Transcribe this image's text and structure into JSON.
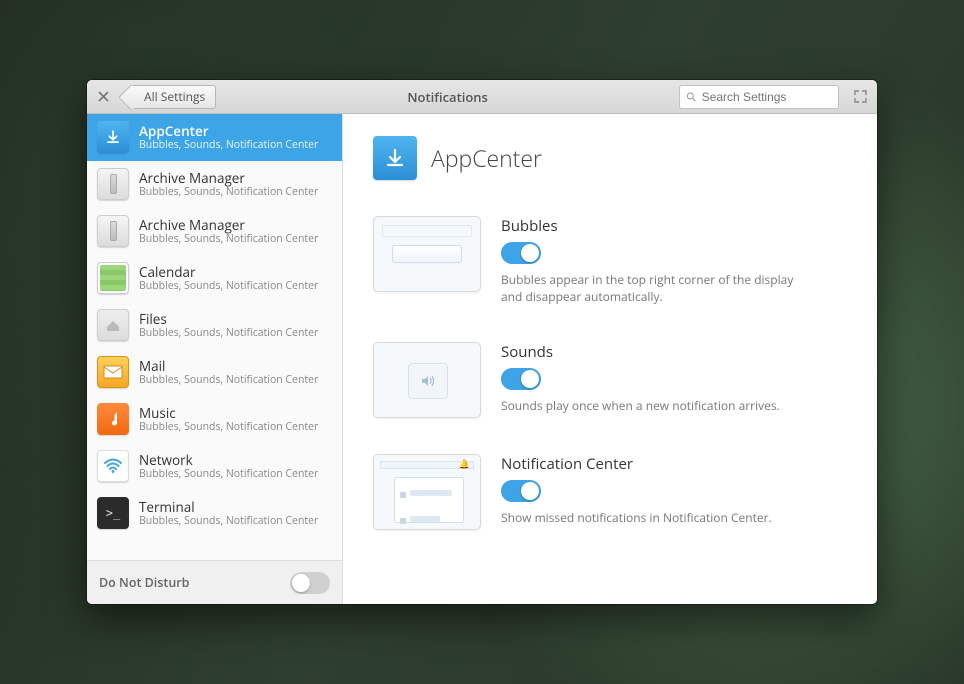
{
  "header": {
    "title": "Notifications",
    "back_label": "All Settings",
    "search_placeholder": "Search Settings"
  },
  "sidebar": {
    "items": [
      {
        "name": "AppCenter",
        "sub": "Bubbles, Sounds, Notification Center",
        "icon": "appcenter",
        "selected": true
      },
      {
        "name": "Archive Manager",
        "sub": "Bubbles, Sounds, Notification Center",
        "icon": "archive"
      },
      {
        "name": "Archive Manager",
        "sub": "Bubbles, Sounds, Notification Center",
        "icon": "archive"
      },
      {
        "name": "Calendar",
        "sub": "Bubbles, Sounds, Notification Center",
        "icon": "calendar"
      },
      {
        "name": "Files",
        "sub": "Bubbles, Sounds, Notification Center",
        "icon": "files"
      },
      {
        "name": "Mail",
        "sub": "Bubbles, Sounds, Notification Center",
        "icon": "mail"
      },
      {
        "name": "Music",
        "sub": "Bubbles, Sounds, Notification Center",
        "icon": "music"
      },
      {
        "name": "Network",
        "sub": "Bubbles, Sounds, Notification Center",
        "icon": "network"
      },
      {
        "name": "Terminal",
        "sub": "Bubbles, Sounds, Notification Center",
        "icon": "terminal"
      }
    ],
    "dnd_label": "Do Not Disturb",
    "dnd_on": false
  },
  "main": {
    "app_name": "AppCenter",
    "settings": [
      {
        "key": "bubbles",
        "title": "Bubbles",
        "desc": "Bubbles appear in the top right corner of the display and disappear automatically.",
        "on": true
      },
      {
        "key": "sounds",
        "title": "Sounds",
        "desc": "Sounds play once when a new notification arrives.",
        "on": true
      },
      {
        "key": "nc",
        "title": "Notification Center",
        "desc": "Show missed notifications in Notification Center.",
        "on": true
      }
    ]
  },
  "icons": {
    "appcenter": "↓",
    "archive": "▌",
    "files": "⌂",
    "mail": "✉",
    "music": "♪",
    "network": "≋",
    "terminal": ">_"
  }
}
